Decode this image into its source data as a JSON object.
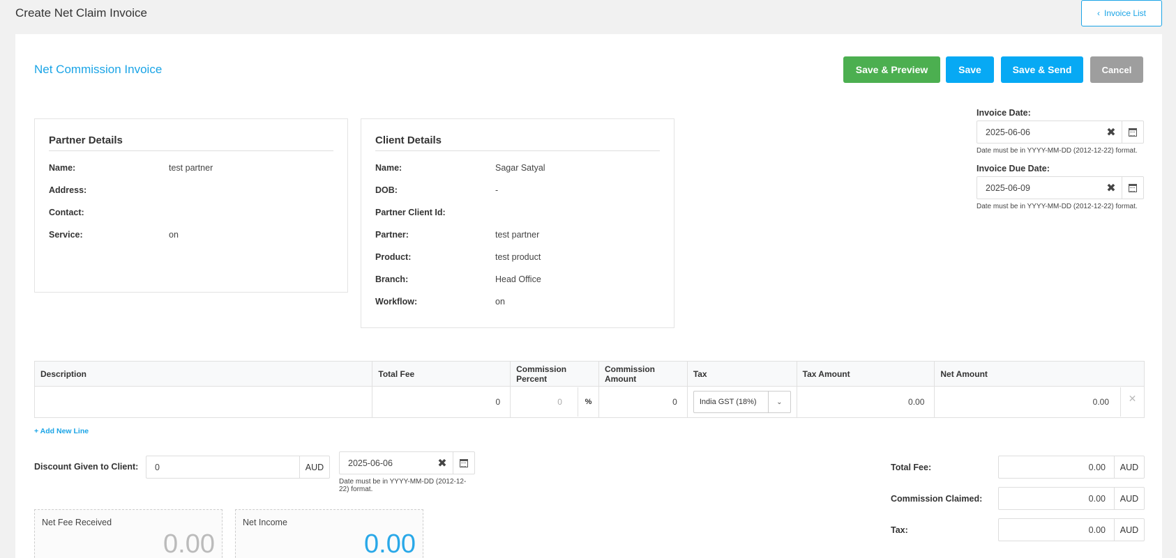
{
  "header": {
    "title": "Create Net Claim Invoice",
    "invoice_list_label": "Invoice List"
  },
  "form": {
    "subtitle": "Net Commission Invoice",
    "actions": {
      "save_preview": "Save & Preview",
      "save": "Save",
      "save_send": "Save & Send",
      "cancel": "Cancel"
    }
  },
  "partner": {
    "title": "Partner Details",
    "rows": [
      {
        "label": "Name:",
        "value": "test partner"
      },
      {
        "label": "Address:",
        "value": ""
      },
      {
        "label": "Contact:",
        "value": ""
      },
      {
        "label": "Service:",
        "value": "on"
      }
    ]
  },
  "client": {
    "title": "Client Details",
    "rows": [
      {
        "label": "Name:",
        "value": "Sagar Satyal"
      },
      {
        "label": "DOB:",
        "value": "-"
      },
      {
        "label": "Partner Client Id:",
        "value": ""
      },
      {
        "label": "Partner:",
        "value": "test partner"
      },
      {
        "label": "Product:",
        "value": "test product"
      },
      {
        "label": "Branch:",
        "value": "Head Office"
      },
      {
        "label": "Workflow:",
        "value": "on"
      }
    ]
  },
  "dates": {
    "invoice_date_label": "Invoice Date:",
    "invoice_date": "2025-06-06",
    "due_date_label": "Invoice Due Date:",
    "due_date": "2025-06-09",
    "hint": "Date must be in YYYY-MM-DD (2012-12-22) format."
  },
  "table": {
    "headers": [
      "Description",
      "Total Fee",
      "Commission Percent",
      "Commission Amount",
      "Tax",
      "Tax Amount",
      "Net Amount"
    ],
    "row": {
      "description": "",
      "total_fee": "0",
      "commission_percent": "0",
      "percent_symbol": "%",
      "commission_amount": "0",
      "tax": "India GST (18%)",
      "tax_amount": "0.00",
      "net_amount": "0.00"
    },
    "add_line": "+ Add New Line"
  },
  "discount": {
    "label": "Discount Given to Client:",
    "value": "0",
    "currency": "AUD",
    "date": "2025-06-06",
    "hint": "Date must be in YYYY-MM-DD (2012-12-22) format."
  },
  "summary": [
    {
      "label": "Total Fee:",
      "value": "0.00",
      "currency": "AUD"
    },
    {
      "label": "Commission Claimed:",
      "value": "0.00",
      "currency": "AUD"
    },
    {
      "label": "Tax:",
      "value": "0.00",
      "currency": "AUD"
    }
  ],
  "stats": {
    "net_fee_label": "Net Fee Received",
    "net_fee_value": "0.00",
    "net_income_label": "Net Income",
    "net_income_value": "0.00"
  },
  "colors": {
    "accent": "#1aa4e6",
    "success": "#4caf50",
    "primary": "#07a9f4",
    "muted": "#9e9e9e"
  }
}
